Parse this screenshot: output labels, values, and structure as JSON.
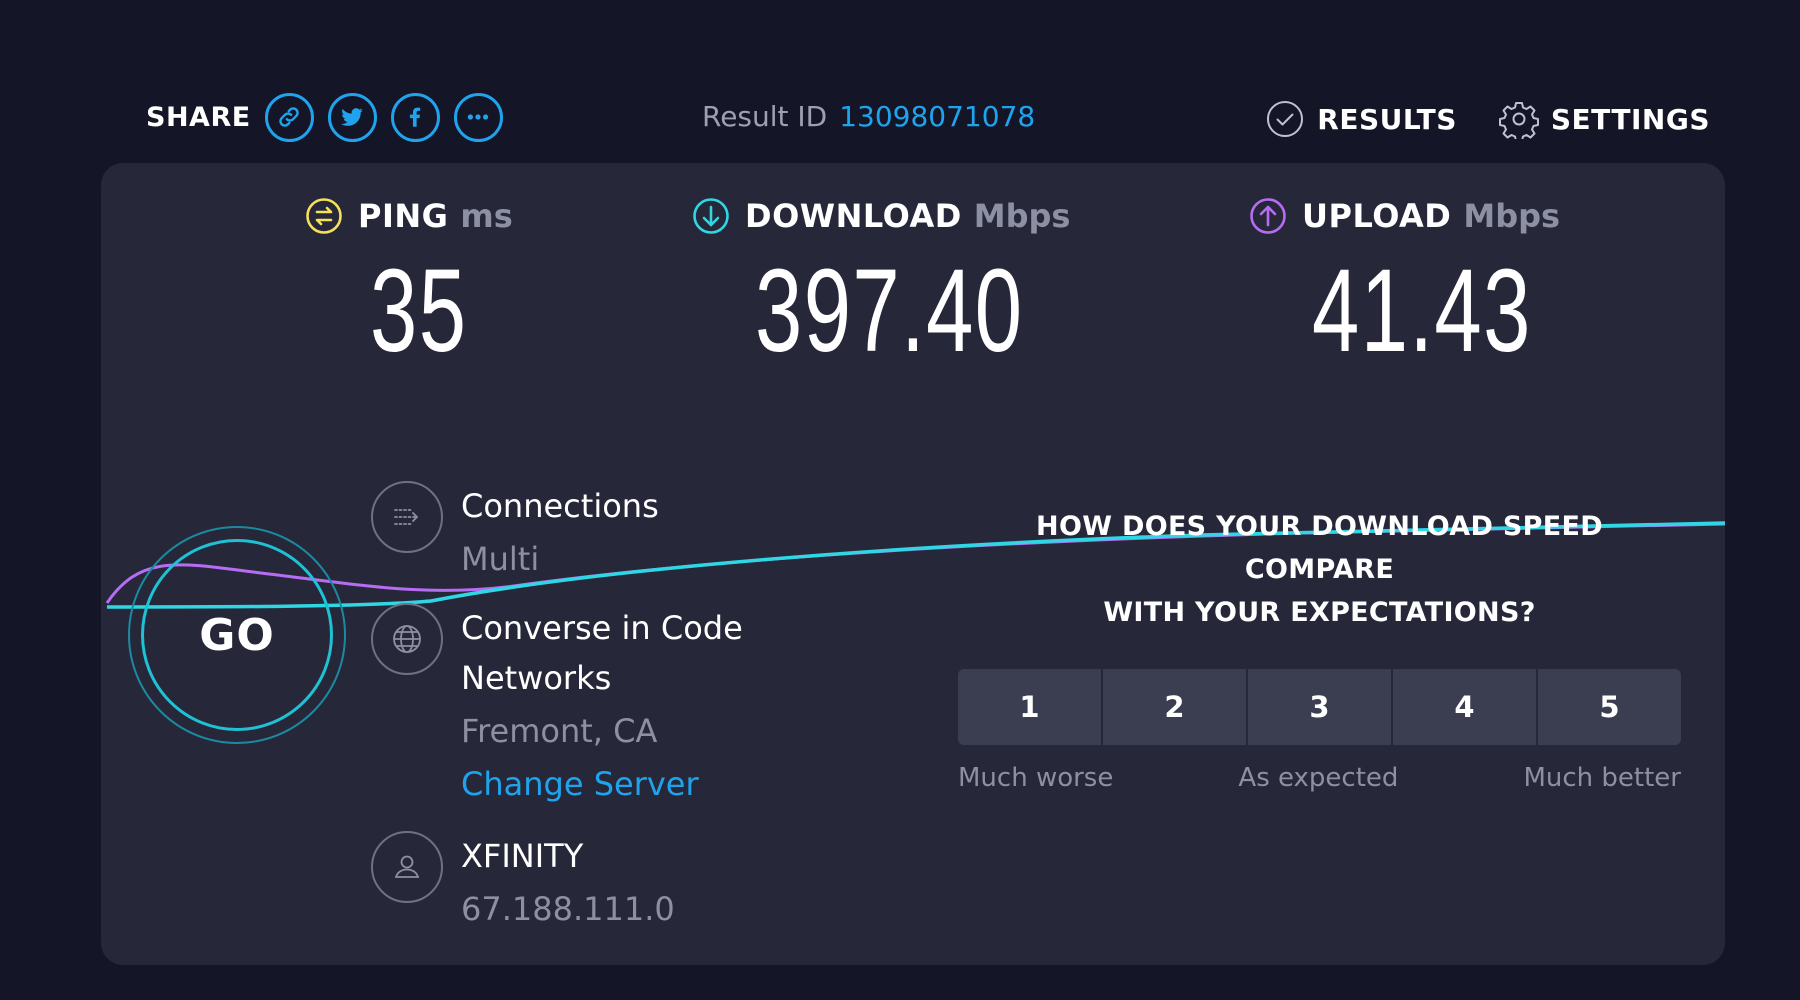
{
  "share": {
    "label": "SHARE",
    "buttons": [
      "link-icon",
      "twitter-icon",
      "facebook-icon",
      "more-icon"
    ]
  },
  "result": {
    "label": "Result ID",
    "id": "13098071078"
  },
  "nav": {
    "results": "RESULTS",
    "settings": "SETTINGS"
  },
  "metrics": {
    "ping": {
      "name": "PING",
      "unit": "ms",
      "value": "35"
    },
    "download": {
      "name": "DOWNLOAD",
      "unit": "Mbps",
      "value": "397.40"
    },
    "upload": {
      "name": "UPLOAD",
      "unit": "Mbps",
      "value": "41.43"
    }
  },
  "go": {
    "label": "GO"
  },
  "connections": {
    "title": "Connections",
    "value": "Multi"
  },
  "server": {
    "name_line1": "Converse in Code",
    "name_line2": "Networks",
    "location": "Fremont, CA",
    "change_link": "Change Server"
  },
  "isp": {
    "name": "XFINITY",
    "ip": "67.188.111.0"
  },
  "survey": {
    "question_line1": "HOW DOES YOUR DOWNLOAD SPEED COMPARE",
    "question_line2": "WITH YOUR EXPECTATIONS?",
    "options": [
      "1",
      "2",
      "3",
      "4",
      "5"
    ],
    "low_label": "Much worse",
    "mid_label": "As expected",
    "high_label": "Much better"
  },
  "colors": {
    "background": "#141526",
    "panel": "#26283a",
    "accent_blue": "#1fa3ec",
    "ping_yellow": "#f4e05a",
    "download_cyan": "#2fd7e4",
    "upload_purple": "#b76cf4"
  }
}
